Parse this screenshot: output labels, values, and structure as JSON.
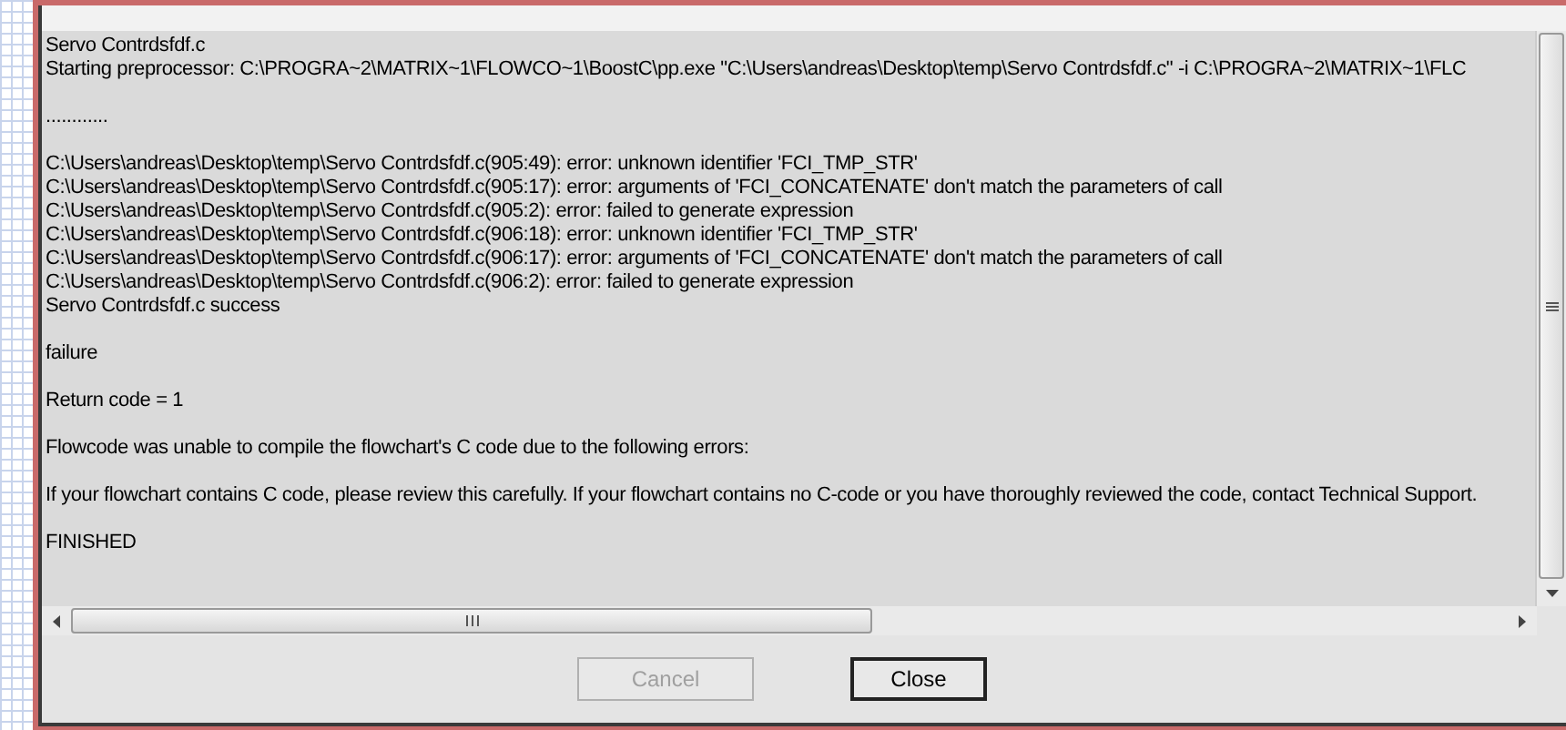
{
  "log": {
    "blocks": [
      {
        "lines": [
          "Servo Contrdsfdf.c",
          "Starting preprocessor: C:\\PROGRA~2\\MATRIX~1\\FLOWCO~1\\BoostC\\pp.exe \"C:\\Users\\andreas\\Desktop\\temp\\Servo Contrdsfdf.c\" -i C:\\PROGRA~2\\MATRIX~1\\FLC"
        ]
      },
      {
        "lines": [
          "............"
        ]
      },
      {
        "lines": [
          "C:\\Users\\andreas\\Desktop\\temp\\Servo Contrdsfdf.c(905:49): error: unknown identifier 'FCI_TMP_STR'",
          "C:\\Users\\andreas\\Desktop\\temp\\Servo Contrdsfdf.c(905:17): error: arguments of 'FCI_CONCATENATE' don't match the parameters of call",
          "C:\\Users\\andreas\\Desktop\\temp\\Servo Contrdsfdf.c(905:2): error: failed to generate expression",
          "C:\\Users\\andreas\\Desktop\\temp\\Servo Contrdsfdf.c(906:18): error: unknown identifier 'FCI_TMP_STR'",
          "C:\\Users\\andreas\\Desktop\\temp\\Servo Contrdsfdf.c(906:17): error: arguments of 'FCI_CONCATENATE' don't match the parameters of call",
          "C:\\Users\\andreas\\Desktop\\temp\\Servo Contrdsfdf.c(906:2): error: failed to generate expression",
          "Servo Contrdsfdf.c success"
        ]
      },
      {
        "lines": [
          "failure"
        ]
      },
      {
        "lines": [
          "Return code = 1"
        ]
      },
      {
        "lines": [
          "Flowcode was unable to compile the flowchart's C code due to the following errors:"
        ]
      },
      {
        "lines": [
          "If your flowchart contains C code, please review this carefully. If your flowchart contains no C-code or you have thoroughly reviewed the code, contact Technical Support."
        ]
      },
      {
        "lines": [
          "FINISHED"
        ]
      }
    ]
  },
  "buttons": [
    {
      "label": "Cancel",
      "disabled": true,
      "default": false
    },
    {
      "label": "Close",
      "disabled": false,
      "default": true
    }
  ]
}
